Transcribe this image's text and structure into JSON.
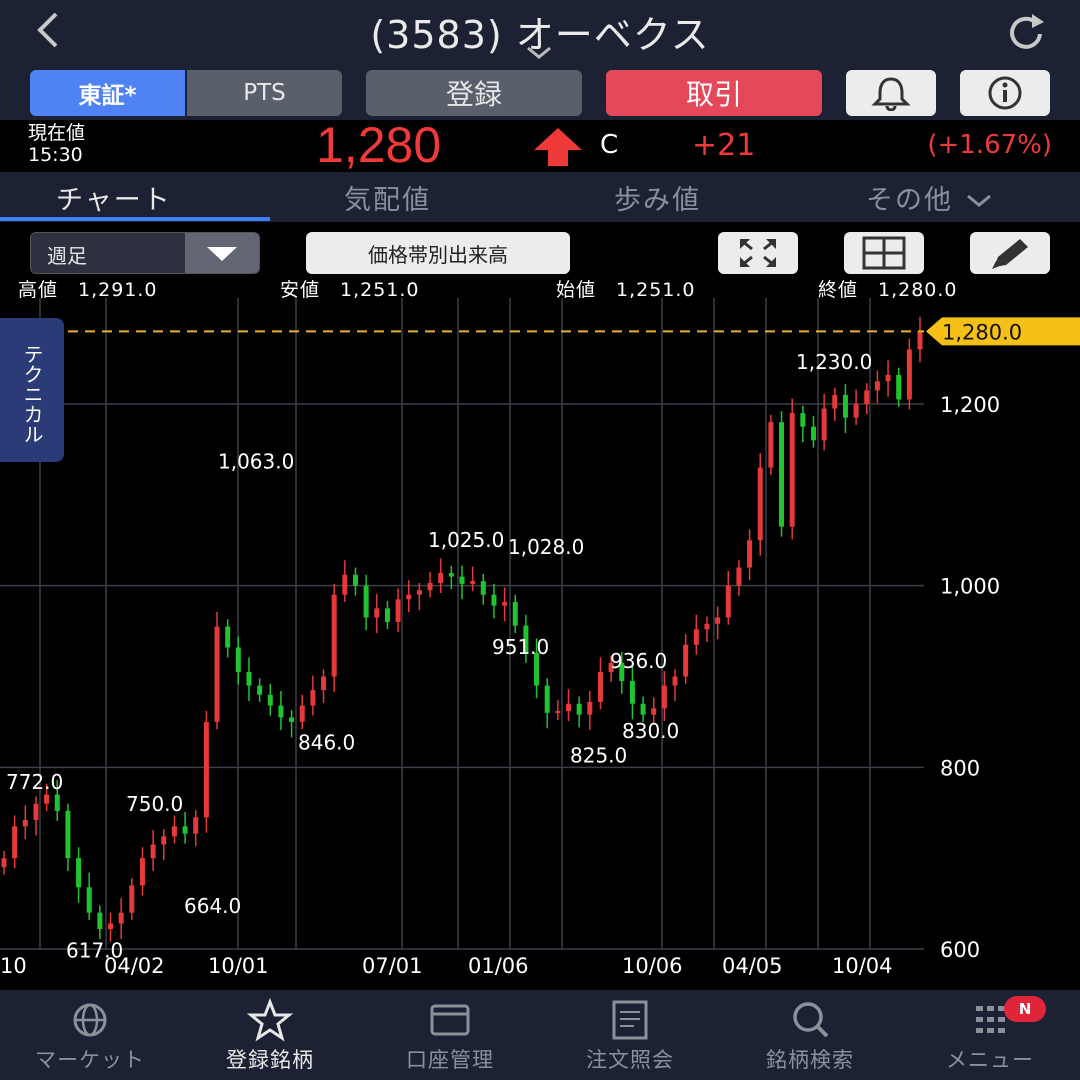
{
  "header": {
    "title": "(3583) オーベクス"
  },
  "buttons": {
    "market_tse": "東証*",
    "market_pts": "PTS",
    "register": "登録",
    "trade": "取引"
  },
  "price": {
    "label": "現在値",
    "time": "15:30",
    "value": "1,280",
    "marker": "C",
    "change": "+21",
    "change_pct": "(+1.67%)",
    "color_up": "#f03a3a"
  },
  "tabs": [
    {
      "label": "チャート",
      "active": true
    },
    {
      "label": "気配値",
      "active": false
    },
    {
      "label": "歩み値",
      "active": false
    },
    {
      "label": "その他",
      "active": false
    }
  ],
  "toolbar": {
    "period": "週足",
    "volume_profile": "価格帯別出来高"
  },
  "ohlc": {
    "high": "高値　1,291.0",
    "low": "安値　1,251.0",
    "open": "始値　1,251.0",
    "close": "終値　1,280.0"
  },
  "side_tab": "テクニカル",
  "chart_data": {
    "type": "candlestick",
    "current_price_label": "1,280.0",
    "current_price": 1280,
    "y_ticks": [
      "1,200",
      "1,000",
      "800",
      "600"
    ],
    "y_values": [
      1200,
      1000,
      800,
      600
    ],
    "x_ticks": [
      "10",
      "04/02",
      "10/01",
      "07/01",
      "01/06",
      "10/06",
      "04/05",
      "10/04"
    ],
    "annotations": [
      {
        "label": "772.0",
        "value": 772
      },
      {
        "label": "750.0",
        "value": 750
      },
      {
        "label": "664.0",
        "value": 664
      },
      {
        "label": "617.0",
        "value": 617
      },
      {
        "label": "1,063.0",
        "value": 1063
      },
      {
        "label": "846.0",
        "value": 846
      },
      {
        "label": "1,025.0",
        "value": 1025
      },
      {
        "label": "1,028.0",
        "value": 1028
      },
      {
        "label": "951.0",
        "value": 951
      },
      {
        "label": "936.0",
        "value": 936
      },
      {
        "label": "825.0",
        "value": 825
      },
      {
        "label": "830.0",
        "value": 830
      },
      {
        "label": "1,230.0",
        "value": 1230
      }
    ],
    "closes": [
      700,
      735,
      742,
      760,
      770,
      752,
      700,
      668,
      640,
      622,
      628,
      640,
      670,
      700,
      715,
      724,
      735,
      727,
      745,
      850,
      955,
      932,
      905,
      890,
      880,
      868,
      855,
      850,
      868,
      885,
      900,
      990,
      1012,
      1000,
      965,
      975,
      960,
      985,
      990,
      995,
      1003,
      1014,
      1010,
      1002,
      1005,
      990,
      978,
      982,
      956,
      926,
      890,
      860,
      862,
      870,
      858,
      872,
      905,
      915,
      895,
      870,
      858,
      865,
      890,
      900,
      935,
      952,
      958,
      965,
      1000,
      1020,
      1050,
      1130,
      1180,
      1065,
      1190,
      1175,
      1160,
      1195,
      1210,
      1185,
      1200,
      1215,
      1225,
      1232,
      1205,
      1260,
      1280
    ],
    "up_color": "#e63a3a",
    "down_color": "#1fc42e"
  },
  "bottom_nav": [
    {
      "label": "マーケット",
      "icon": "globe-icon",
      "active": false
    },
    {
      "label": "登録銘柄",
      "icon": "star-icon",
      "active": true
    },
    {
      "label": "口座管理",
      "icon": "wallet-icon",
      "active": false
    },
    {
      "label": "注文照会",
      "icon": "document-icon",
      "active": false
    },
    {
      "label": "銘柄検索",
      "icon": "search-icon",
      "active": false
    },
    {
      "label": "メニュー",
      "icon": "menu-grid-icon",
      "active": false
    }
  ],
  "badge": "N"
}
